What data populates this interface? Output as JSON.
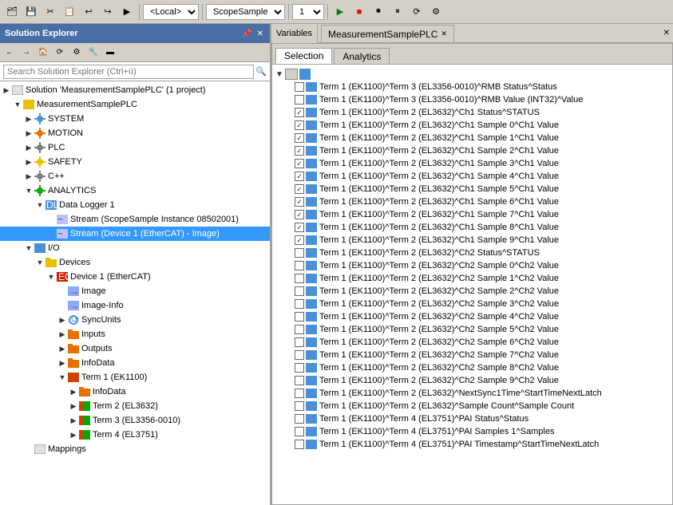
{
  "toolbar": {
    "local_label": "<Local>",
    "scope_label": "ScopeSample",
    "instance_label": "1"
  },
  "solution_explorer": {
    "title": "Solution Explorer",
    "search_placeholder": "Search Solution Explorer (Ctrl+ü)",
    "tree": [
      {
        "id": "solution",
        "indent": 0,
        "expand": "▶",
        "icon": "solution",
        "label": "Solution 'MeasurementSamplePLC' (1 project)"
      },
      {
        "id": "measurement",
        "indent": 1,
        "expand": "▼",
        "icon": "plc-yellow",
        "label": "MeasurementSamplePLC"
      },
      {
        "id": "system",
        "indent": 2,
        "expand": "▶",
        "icon": "gear-blue",
        "label": "SYSTEM"
      },
      {
        "id": "motion",
        "indent": 2,
        "expand": "▶",
        "icon": "gear-orange",
        "label": "MOTION"
      },
      {
        "id": "plc",
        "indent": 2,
        "expand": "▶",
        "icon": "gear-gray",
        "label": "PLC"
      },
      {
        "id": "safety",
        "indent": 2,
        "expand": "▶",
        "icon": "gear-yellow",
        "label": "SAFETY"
      },
      {
        "id": "cpp",
        "indent": 2,
        "expand": "▶",
        "icon": "gear-gray",
        "label": "C++"
      },
      {
        "id": "analytics",
        "indent": 2,
        "expand": "▼",
        "icon": "gear-green",
        "label": "ANALYTICS"
      },
      {
        "id": "datalogger1",
        "indent": 3,
        "expand": "▼",
        "icon": "datalogger",
        "label": "Data Logger 1"
      },
      {
        "id": "stream1",
        "indent": 4,
        "expand": "",
        "icon": "stream",
        "label": "Stream (ScopeSample Instance 08502001)"
      },
      {
        "id": "stream2",
        "indent": 4,
        "expand": "",
        "icon": "stream",
        "label": "Stream (Device 1 (EtherCAT) - Image)",
        "selected": true
      },
      {
        "id": "io",
        "indent": 2,
        "expand": "▼",
        "icon": "io-blue",
        "label": "I/O"
      },
      {
        "id": "devices",
        "indent": 3,
        "expand": "▼",
        "icon": "folder",
        "label": "Devices"
      },
      {
        "id": "device1",
        "indent": 4,
        "expand": "▼",
        "icon": "ethercat",
        "label": "Device 1 (EtherCAT)"
      },
      {
        "id": "image",
        "indent": 5,
        "expand": "",
        "icon": "img-arrow",
        "label": "Image"
      },
      {
        "id": "image-info",
        "indent": 5,
        "expand": "",
        "icon": "img-arrow",
        "label": "Image-Info"
      },
      {
        "id": "syncunits",
        "indent": 5,
        "expand": "▶",
        "icon": "sync",
        "label": "SyncUnits"
      },
      {
        "id": "inputs",
        "indent": 5,
        "expand": "▶",
        "icon": "folder-orange",
        "label": "Inputs"
      },
      {
        "id": "outputs",
        "indent": 5,
        "expand": "▶",
        "icon": "folder-orange",
        "label": "Outputs"
      },
      {
        "id": "infodata",
        "indent": 5,
        "expand": "▶",
        "icon": "folder-orange",
        "label": "InfoData"
      },
      {
        "id": "term1",
        "indent": 5,
        "expand": "▼",
        "icon": "ek1100",
        "label": "Term 1 (EK1100)"
      },
      {
        "id": "infodata2",
        "indent": 6,
        "expand": "▶",
        "icon": "folder-orange",
        "label": "InfoData"
      },
      {
        "id": "term2",
        "indent": 6,
        "expand": "▶",
        "icon": "el3632",
        "label": "Term 2 (EL3632)"
      },
      {
        "id": "term3",
        "indent": 6,
        "expand": "▶",
        "icon": "el3356",
        "label": "Term 3 (EL3356-0010)"
      },
      {
        "id": "term4",
        "indent": 6,
        "expand": "▶",
        "icon": "el3751",
        "label": "Term 4 (EL3751)"
      },
      {
        "id": "mappings",
        "indent": 2,
        "expand": "",
        "icon": "mappings",
        "label": "Mappings"
      }
    ]
  },
  "right_panel": {
    "variables_label": "Variables",
    "tab_label": "MeasurementSamplePLC",
    "inner_tabs": [
      "Selection",
      "Analytics"
    ],
    "active_inner_tab": "Selection",
    "variables": [
      {
        "checked": false,
        "color": "#4a90d9",
        "text": "Term 1 (EK1100)^Term 3 (EL3356-0010)^RMB Status^Status"
      },
      {
        "checked": false,
        "color": "#4a90d9",
        "text": "Term 1 (EK1100)^Term 3 (EL3356-0010)^RMB Value (INT32)^Value"
      },
      {
        "checked": true,
        "color": "#4a90d9",
        "text": "Term 1 (EK1100)^Term 2 (EL3632)^Ch1 Status^STATUS"
      },
      {
        "checked": true,
        "color": "#4a90d9",
        "text": "Term 1 (EK1100)^Term 2 (EL3632)^Ch1 Sample 0^Ch1 Value"
      },
      {
        "checked": true,
        "color": "#4a90d9",
        "text": "Term 1 (EK1100)^Term 2 (EL3632)^Ch1 Sample 1^Ch1 Value"
      },
      {
        "checked": true,
        "color": "#4a90d9",
        "text": "Term 1 (EK1100)^Term 2 (EL3632)^Ch1 Sample 2^Ch1 Value"
      },
      {
        "checked": true,
        "color": "#4a90d9",
        "text": "Term 1 (EK1100)^Term 2 (EL3632)^Ch1 Sample 3^Ch1 Value"
      },
      {
        "checked": true,
        "color": "#4a90d9",
        "text": "Term 1 (EK1100)^Term 2 (EL3632)^Ch1 Sample 4^Ch1 Value"
      },
      {
        "checked": true,
        "color": "#4a90d9",
        "text": "Term 1 (EK1100)^Term 2 (EL3632)^Ch1 Sample 5^Ch1 Value"
      },
      {
        "checked": true,
        "color": "#4a90d9",
        "text": "Term 1 (EK1100)^Term 2 (EL3632)^Ch1 Sample 6^Ch1 Value"
      },
      {
        "checked": true,
        "color": "#4a90d9",
        "text": "Term 1 (EK1100)^Term 2 (EL3632)^Ch1 Sample 7^Ch1 Value"
      },
      {
        "checked": true,
        "color": "#4a90d9",
        "text": "Term 1 (EK1100)^Term 2 (EL3632)^Ch1 Sample 8^Ch1 Value"
      },
      {
        "checked": true,
        "color": "#4a90d9",
        "text": "Term 1 (EK1100)^Term 2 (EL3632)^Ch1 Sample 9^Ch1 Value"
      },
      {
        "checked": false,
        "color": "#4a90d9",
        "text": "Term 1 (EK1100)^Term 2 (EL3632)^Ch2 Status^STATUS"
      },
      {
        "checked": false,
        "color": "#4a90d9",
        "text": "Term 1 (EK1100)^Term 2 (EL3632)^Ch2 Sample 0^Ch2 Value"
      },
      {
        "checked": false,
        "color": "#4a90d9",
        "text": "Term 1 (EK1100)^Term 2 (EL3632)^Ch2 Sample 1^Ch2 Value"
      },
      {
        "checked": false,
        "color": "#4a90d9",
        "text": "Term 1 (EK1100)^Term 2 (EL3632)^Ch2 Sample 2^Ch2 Value"
      },
      {
        "checked": false,
        "color": "#4a90d9",
        "text": "Term 1 (EK1100)^Term 2 (EL3632)^Ch2 Sample 3^Ch2 Value"
      },
      {
        "checked": false,
        "color": "#4a90d9",
        "text": "Term 1 (EK1100)^Term 2 (EL3632)^Ch2 Sample 4^Ch2 Value"
      },
      {
        "checked": false,
        "color": "#4a90d9",
        "text": "Term 1 (EK1100)^Term 2 (EL3632)^Ch2 Sample 5^Ch2 Value"
      },
      {
        "checked": false,
        "color": "#4a90d9",
        "text": "Term 1 (EK1100)^Term 2 (EL3632)^Ch2 Sample 6^Ch2 Value"
      },
      {
        "checked": false,
        "color": "#4a90d9",
        "text": "Term 1 (EK1100)^Term 2 (EL3632)^Ch2 Sample 7^Ch2 Value"
      },
      {
        "checked": false,
        "color": "#4a90d9",
        "text": "Term 1 (EK1100)^Term 2 (EL3632)^Ch2 Sample 8^Ch2 Value"
      },
      {
        "checked": false,
        "color": "#4a90d9",
        "text": "Term 1 (EK1100)^Term 2 (EL3632)^Ch2 Sample 9^Ch2 Value"
      },
      {
        "checked": false,
        "color": "#4a90d9",
        "text": "Term 1 (EK1100)^Term 2 (EL3632)^NextSync1Time^StartTimeNextLatch"
      },
      {
        "checked": false,
        "color": "#4a90d9",
        "text": "Term 1 (EK1100)^Term 2 (EL3632)^Sample Count^Sample Count"
      },
      {
        "checked": false,
        "color": "#4a90d9",
        "text": "Term 1 (EK1100)^Term 4 (EL3751)^PAI Status^Status"
      },
      {
        "checked": false,
        "color": "#4a90d9",
        "text": "Term 1 (EK1100)^Term 4 (EL3751)^PAI Samples 1^Samples"
      },
      {
        "checked": false,
        "color": "#4a90d9",
        "text": "Term 1 (EK1100)^Term 4 (EL3751)^PAI Timestamp^StartTimeNextLatch"
      }
    ]
  }
}
